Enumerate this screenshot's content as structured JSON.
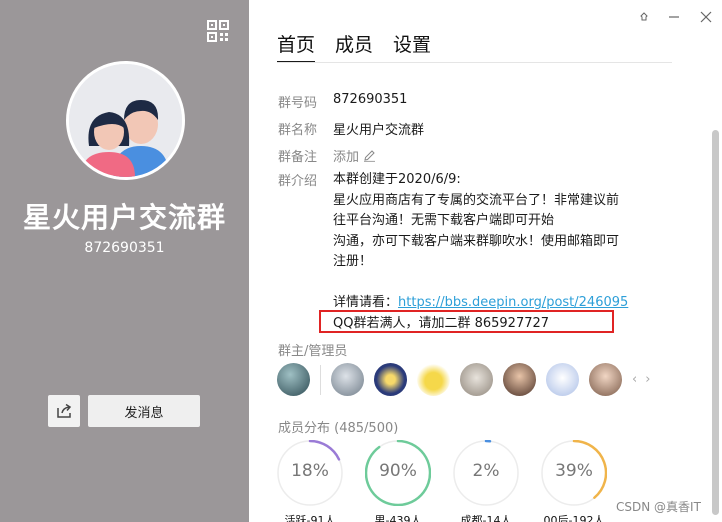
{
  "left_panel": {
    "group_name": "星火用户交流群",
    "group_number": "872690351",
    "send_message_label": "发消息"
  },
  "tabs": [
    {
      "label": "首页",
      "active": true
    },
    {
      "label": "成员",
      "active": false
    },
    {
      "label": "设置",
      "active": false
    }
  ],
  "info": {
    "group_id_label": "群号码",
    "group_id_value": "872690351",
    "group_name_label": "群名称",
    "group_name_value": "星火用户交流群",
    "group_remark_label": "群备注",
    "group_remark_value": "添加",
    "group_intro_label": "群介绍",
    "intro_lines": [
      "本群创建于2020/6/9:",
      "星火应用商店有了专属的交流平台了！非常建议前",
      "往平台沟通！无需下载客户端即可开始",
      "沟通，亦可下载客户端来群聊吹水！使用邮箱即可",
      "注册！"
    ],
    "details_prefix": "详情请看：",
    "details_link": "https://bbs.deepin.org/post/246095",
    "qq_notice": "QQ群若满人，请加二群 865927727"
  },
  "admins": {
    "title": "群主/管理员",
    "avatar_colors": [
      "#4a6d74",
      "#8e9aa6",
      "#3a4d8a",
      "#f2d040",
      "#b9b2a8",
      "#6a4a3c",
      "#c9d6ef",
      "#9a7a6a"
    ]
  },
  "distribution": {
    "title": "成员分布",
    "count_text": "(485/500)",
    "items": [
      {
        "percent_label": "18%",
        "value": 0.18,
        "color": "#9a7bd6",
        "caption": "活跃-91人"
      },
      {
        "percent_label": "90%",
        "value": 0.9,
        "color": "#6ecb9a",
        "caption": "男-439人"
      },
      {
        "percent_label": "2%",
        "value": 0.02,
        "color": "#4a8fe0",
        "caption": "成都-14人"
      },
      {
        "percent_label": "39%",
        "value": 0.39,
        "color": "#f0b44a",
        "caption": "00后-192人"
      }
    ]
  },
  "watermark": "CSDN @真香IT"
}
